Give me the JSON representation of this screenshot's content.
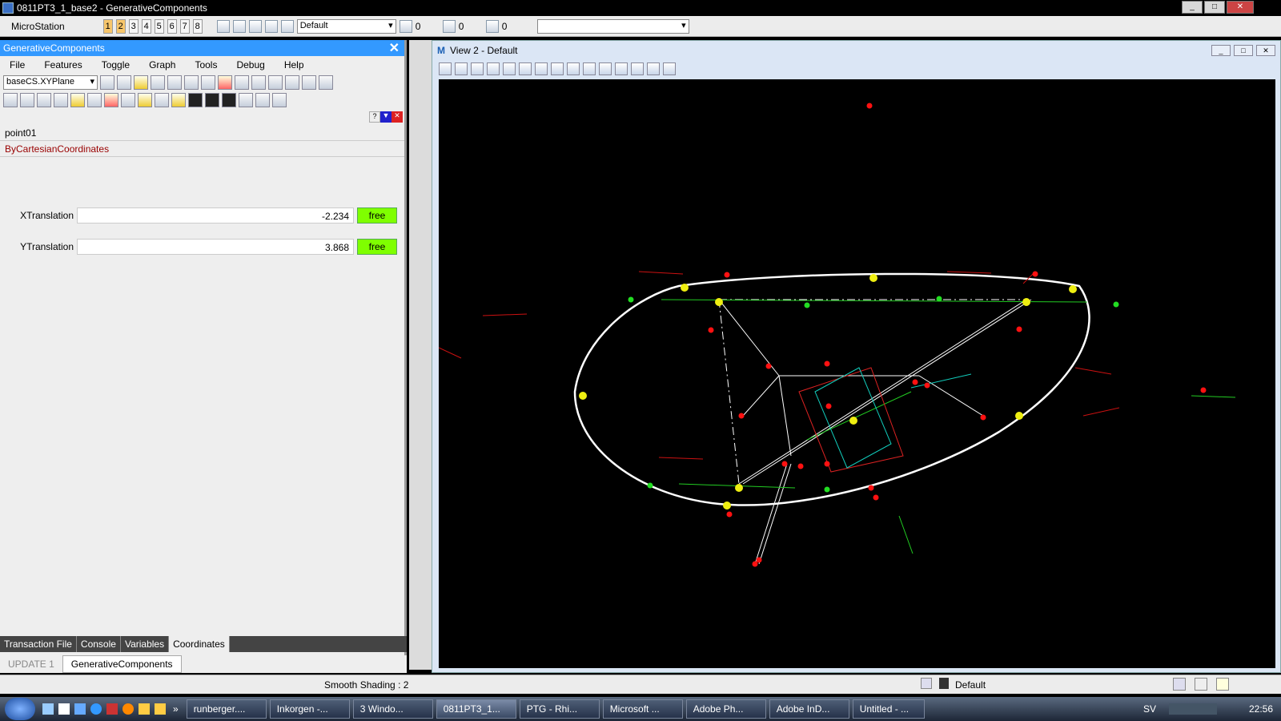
{
  "window": {
    "title": "0811PT3_1_base2 - GenerativeComponents"
  },
  "ms_toolbar": {
    "label": "MicroStation",
    "nums": [
      "1",
      "2",
      "3",
      "4",
      "5",
      "6",
      "7",
      "8"
    ],
    "level_combo": "Default",
    "color_val": "0",
    "style_val": "0",
    "weight_val": "0"
  },
  "panel": {
    "title": "GenerativeComponents",
    "close": "✕",
    "menus": [
      "File",
      "Features",
      "Toggle",
      "Graph",
      "Tools",
      "Debug",
      "Help"
    ],
    "cs_combo": "baseCS.XYPlane",
    "feature_name": "point01",
    "technique": "ByCartesianCoordinates",
    "params": [
      {
        "label": "XTranslation",
        "value": "-2.234",
        "state": "free"
      },
      {
        "label": "YTranslation",
        "value": "3.868",
        "state": "free"
      }
    ],
    "tabs": [
      "Transaction File",
      "Console",
      "Variables",
      "Coordinates"
    ],
    "tabs2": [
      "UPDATE 1",
      "GenerativeComponents"
    ]
  },
  "view": {
    "title": "View 2 - Default"
  },
  "status": {
    "shading": "Smooth Shading : 2",
    "level": "Default"
  },
  "taskbar": {
    "items": [
      "runberger....",
      "Inkorgen -...",
      "3 Windo...",
      "0811PT3_1...",
      "PTG - Rhi...",
      "Microsoft ...",
      "Adobe Ph...",
      "Adobe InD...",
      "Untitled - ..."
    ],
    "lang": "SV",
    "clock": "22:56"
  }
}
